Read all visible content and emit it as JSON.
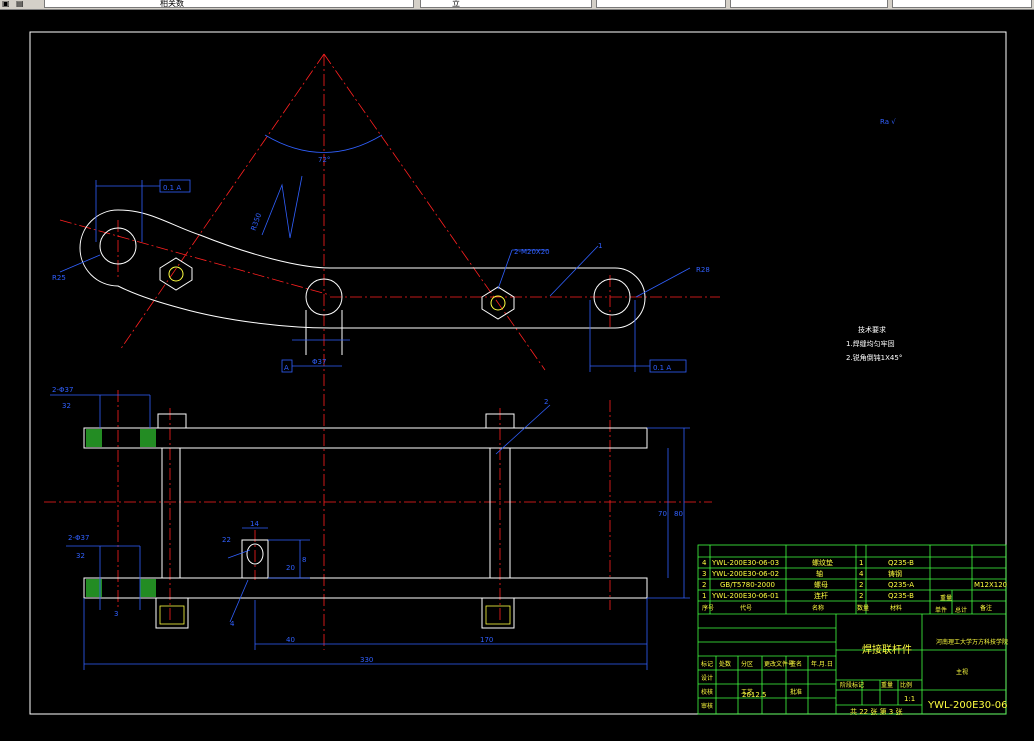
{
  "toolbar": {
    "field_1": "",
    "field_2_value": "相关数",
    "field_3_value": "立",
    "field_4_value": "",
    "field_5_value": "",
    "field_6_value": ""
  },
  "drawing": {
    "angle_label": "72°",
    "left_radius_label": "R25",
    "right_radius_label": "R28",
    "hole_label": "2-M20X20",
    "leader_label_1": "1",
    "datum_A": "A",
    "diameter_label": "Φ37",
    "arc_radius_label": "R350",
    "tolerance_top": "0.1  A",
    "tolerance_right": "0.1  A",
    "roughness_mark": "Ra √",
    "notes_title": "技术要求",
    "note_1": "1.焊缝均匀牢固",
    "note_2": "2.锐角倒钝1X45°",
    "left_hole_label_top": "2-Φ37",
    "left_hole_label_top_sub": "32",
    "left_hole_label_bottom": "2-Φ37",
    "left_hole_label_bottom_sub": "32",
    "leader_label_2": "2",
    "leader_label_3": "3",
    "leader_label_4": "4",
    "slot_dim_top": "14",
    "slot_dim_side": "22",
    "slot_dim_height": "8",
    "slot_dim_left": "20",
    "dim_40": "40",
    "dim_170": "170",
    "dim_330": "330",
    "dim_height_1": "70",
    "dim_height_2": "80"
  },
  "bom": [
    {
      "no": "4",
      "code": "YWL-200E30-06-03",
      "name": "螺纹垫",
      "qty": "1",
      "material": "Q235-B",
      "note": ""
    },
    {
      "no": "3",
      "code": "YWL-200E30-06-02",
      "name": "轴",
      "qty": "4",
      "material": "铸钢",
      "note": ""
    },
    {
      "no": "2",
      "code": "GB/T5780-2000",
      "name": "螺母",
      "qty": "2",
      "material": "Q235-A",
      "note": "M12X120"
    },
    {
      "no": "1",
      "code": "YWL-200E30-06-01",
      "name": "连杆",
      "qty": "2",
      "material": "Q235-B",
      "note": ""
    }
  ],
  "bom_header": {
    "no": "序号",
    "code": "代号",
    "name": "名称",
    "qty": "数量",
    "material": "材料",
    "weight_single": "单件",
    "weight_total": "总计",
    "weight": "重量",
    "note": "备注"
  },
  "title_block": {
    "part_name": "焊接联杆件",
    "company": "河南理工大学万方科技学院",
    "drawing_type": "主视",
    "drawing_no": "YWL-200E30-06",
    "scale": "1:1",
    "sheet_info": "共 22 张 第 3 张",
    "date": "2012.5",
    "row_labels": [
      "标记",
      "处数",
      "分区",
      "更改文件号",
      "签名",
      "年.月.日"
    ],
    "row_labels_2": [
      "设计",
      "校核",
      "审核",
      "工艺",
      "批准"
    ],
    "stage_labels": [
      "阶段标记",
      "重量",
      "比例"
    ]
  }
}
